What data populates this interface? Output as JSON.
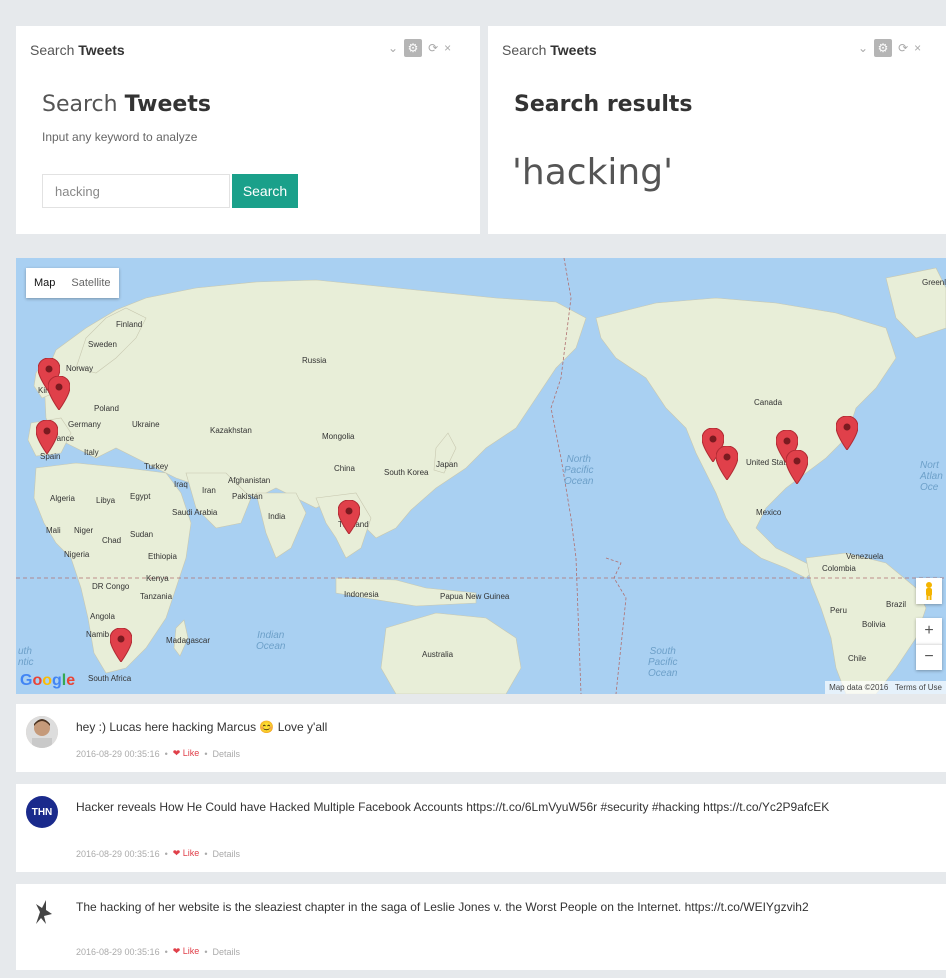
{
  "panels": [
    {
      "header_light": "Search",
      "header_bold": "Tweets",
      "title_light": "Search",
      "title_bold": "Tweets",
      "hint": "Input any keyword to analyze",
      "input_value": "hacking",
      "search_button": "Search"
    },
    {
      "header_light": "Search",
      "header_bold": "Tweets",
      "title": "Search results",
      "query": "'hacking'"
    }
  ],
  "map": {
    "type_map": "Map",
    "type_satellite": "Satellite",
    "zoom_in": "+",
    "zoom_out": "−",
    "attribution_data": "Map data ©2016",
    "attribution_terms": "Terms of Use",
    "logo": "Google",
    "labels": {
      "finland": "Finland",
      "sweden": "Sweden",
      "norway": "Norway",
      "russia": "Russia",
      "poland": "Poland",
      "germany": "Germany",
      "ukraine": "Ukraine",
      "france": "rance",
      "italy": "Italy",
      "spain": "Spain",
      "kingdom": "Kingd",
      "kazakhstan": "Kazakhstan",
      "mongolia": "Mongolia",
      "turkey": "Turkey",
      "iraq": "Iraq",
      "iran": "Iran",
      "afghanistan": "Afghanistan",
      "pakistan": "Pakistan",
      "china": "China",
      "japan": "Japan",
      "south_korea": "South Korea",
      "india": "India",
      "thailand": "Thailand",
      "algeria": "Algeria",
      "libya": "Libya",
      "egypt": "Egypt",
      "saudi": "Saudi Arabia",
      "mali": "Mali",
      "niger": "Niger",
      "chad": "Chad",
      "sudan": "Sudan",
      "nigeria": "Nigeria",
      "ethiopia": "Ethiopia",
      "kenya": "Kenya",
      "dr_congo": "DR Congo",
      "tanzania": "Tanzania",
      "angola": "Angola",
      "namibia": "Namib",
      "madagascar": "Madagascar",
      "south_africa": "South Africa",
      "indonesia": "Indonesia",
      "png": "Papua New Guinea",
      "australia": "Australia",
      "canada": "Canada",
      "united_states": "United States",
      "mexico": "Mexico",
      "venezuela": "Venezuela",
      "colombia": "Colombia",
      "peru": "Peru",
      "brazil": "Brazil",
      "bolivia": "Bolivia",
      "chile": "Chile",
      "greenland": "Greenl"
    },
    "oceans": {
      "north_pacific": "North\nPacific\nOcean",
      "south_pacific": "South\nPacific\nOcean",
      "indian": "Indian\nOcean",
      "north_atlantic": "Nort\nAtlan\nOce",
      "south_atlantic": "uth\nntic"
    }
  },
  "tweets": [
    {
      "text": "hey :) Lucas here hacking Marcus 😊 Love y'all",
      "timestamp": "2016-08-29 00:35:16",
      "like": "Like",
      "details": "Details"
    },
    {
      "avatar_text": "THN",
      "text": "Hacker reveals How He Could have Hacked Multiple Facebook Accounts https://t.co/6LmVyuW56r #security #hacking https://t.co/Yc2P9afcEK",
      "timestamp": "2016-08-29 00:35:16",
      "like": "Like",
      "details": "Details"
    },
    {
      "text": "The hacking of her website is the sleaziest chapter in the saga of Leslie Jones v. the Worst People on the Internet. https://t.co/WEIYgzvih2",
      "timestamp": "2016-08-29 00:35:16",
      "like": "Like",
      "details": "Details"
    }
  ],
  "colors": {
    "accent": "#1aa08a",
    "ocean": "#a9d0f2",
    "land": "#e8eed8",
    "marker": "#e0404a"
  }
}
